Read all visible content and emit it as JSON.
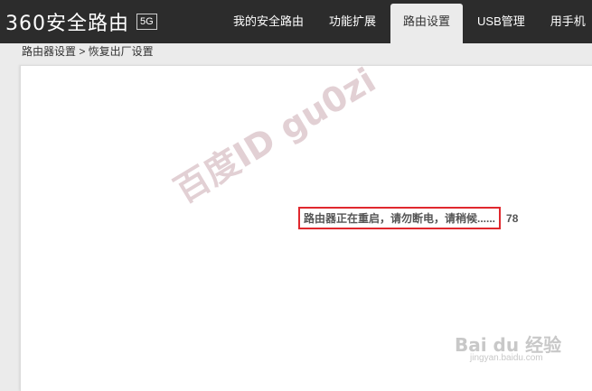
{
  "header": {
    "logo_text": "360安全路由",
    "logo_badge": "5G",
    "tabs": [
      {
        "label": "我的安全路由",
        "active": false
      },
      {
        "label": "功能扩展",
        "active": false
      },
      {
        "label": "路由设置",
        "active": true
      },
      {
        "label": "USB管理",
        "active": false
      },
      {
        "label": "用手机",
        "active": false
      }
    ]
  },
  "breadcrumb": "路由器设置 > 恢复出厂设置",
  "main": {
    "status_message": "路由器正在重启，请勿断电，请稍候......",
    "countdown": "78"
  },
  "watermark": {
    "text": "百度ID gu0zi",
    "baidu_logo": "Bai du 经验",
    "baidu_url": "jingyan.baidu.com"
  },
  "colors": {
    "topbar_bg": "#2c2c2c",
    "highlight_border": "#e0282e",
    "page_bg": "#ebebeb"
  }
}
